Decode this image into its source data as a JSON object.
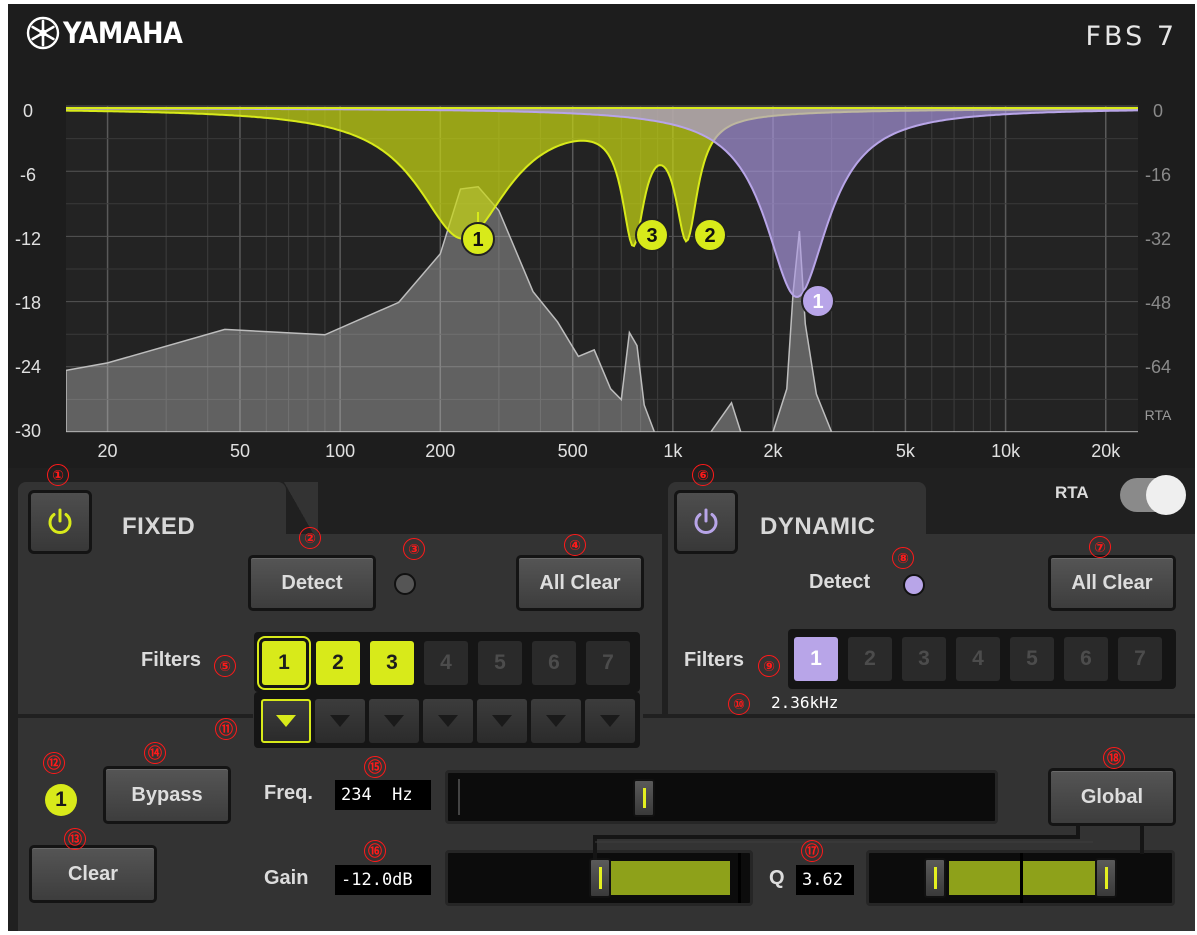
{
  "header": {
    "brand": "YAMAHA",
    "product": "FBS 7"
  },
  "graph": {
    "y_left_ticks": [
      "0",
      "-6",
      "-12",
      "-18",
      "-24",
      "-30"
    ],
    "y_right_ticks": [
      "0",
      "-16",
      "-32",
      "-48",
      "-64",
      "RTA"
    ],
    "x_ticks": [
      "20",
      "50",
      "100",
      "200",
      "500",
      "1k",
      "2k",
      "5k",
      "10k",
      "20k"
    ],
    "filter_markers": [
      {
        "label": "1",
        "color": "#d8ea1a"
      },
      {
        "label": "3",
        "color": "#d8ea1a"
      },
      {
        "label": "2",
        "color": "#d8ea1a"
      },
      {
        "label": "1",
        "color": "#b8a5e8"
      }
    ]
  },
  "fixed": {
    "title": "FIXED",
    "detect_label": "Detect",
    "all_clear_label": "All Clear",
    "filters_label": "Filters",
    "filters": [
      "1",
      "2",
      "3",
      "4",
      "5",
      "6",
      "7"
    ]
  },
  "dynamic": {
    "title": "DYNAMIC",
    "detect_label": "Detect",
    "all_clear_label": "All Clear",
    "filters_label": "Filters",
    "filters": [
      "1",
      "2",
      "3",
      "4",
      "5",
      "6",
      "7"
    ],
    "freq_readout": "2.36kHz"
  },
  "rta_label": "RTA",
  "editor": {
    "selected_filter": "1",
    "bypass_label": "Bypass",
    "clear_label": "Clear",
    "freq_label": "Freq.",
    "freq_value": "234  Hz",
    "gain_label": "Gain",
    "gain_value": "-12.0dB",
    "q_label": "Q",
    "q_value": "3.62",
    "global_label": "Global"
  },
  "annotations": [
    "①",
    "②",
    "③",
    "④",
    "⑤",
    "⑥",
    "⑦",
    "⑧",
    "⑨",
    "⑩",
    "⑪",
    "⑫",
    "⑬",
    "⑭",
    "⑮",
    "⑯",
    "⑰",
    "⑱"
  ],
  "colors": {
    "fixed_accent": "#d8ea1a",
    "dynamic_accent": "#b8a5e8",
    "annotation": "#ff1a1a"
  }
}
